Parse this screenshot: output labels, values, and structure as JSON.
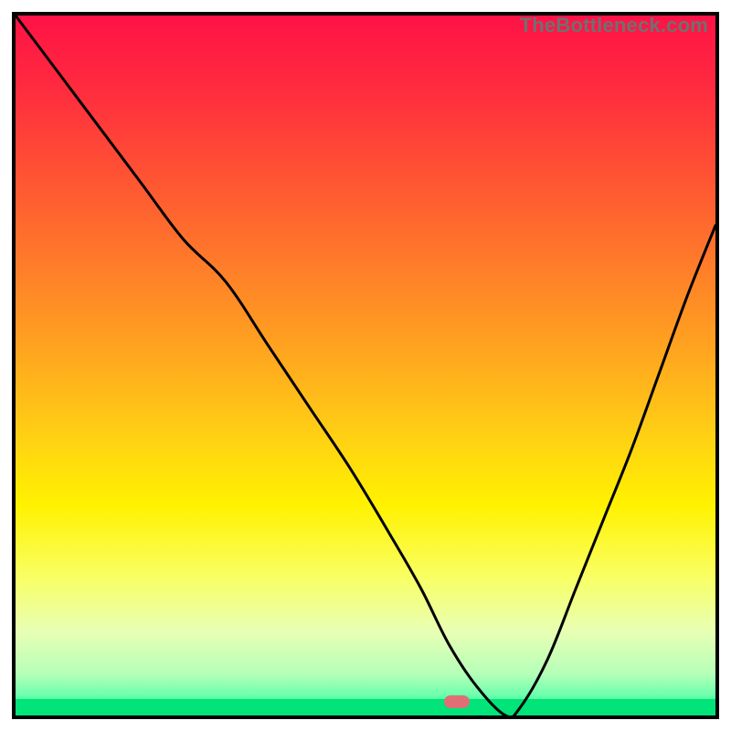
{
  "watermark": {
    "text": "TheBottleneck.com"
  },
  "chart_data": {
    "type": "line",
    "title": "",
    "xlabel": "",
    "ylabel": "",
    "xlim": [
      0,
      100
    ],
    "ylim": [
      0,
      100
    ],
    "grid": false,
    "legend": false,
    "series": [
      {
        "name": "bottleneck-curve",
        "x": [
          0,
          6,
          12,
          18,
          24,
          30,
          36,
          42,
          48,
          54,
          58,
          62,
          66,
          70,
          72,
          76,
          80,
          84,
          88,
          92,
          96,
          100
        ],
        "values": [
          100,
          92,
          84,
          76,
          68,
          62,
          53,
          44,
          35,
          25,
          18,
          10,
          4,
          0,
          1,
          8,
          18,
          28,
          38,
          49,
          60,
          70
        ]
      }
    ],
    "marker": {
      "x": 63,
      "y": 2
    },
    "gradient": {
      "stops": [
        {
          "offset": 0.0,
          "color": "#ff1246"
        },
        {
          "offset": 0.1,
          "color": "#ff2a3f"
        },
        {
          "offset": 0.22,
          "color": "#ff5034"
        },
        {
          "offset": 0.35,
          "color": "#ff7a2a"
        },
        {
          "offset": 0.48,
          "color": "#ffa51f"
        },
        {
          "offset": 0.6,
          "color": "#ffd014"
        },
        {
          "offset": 0.7,
          "color": "#fff200"
        },
        {
          "offset": 0.8,
          "color": "#f9ff62"
        },
        {
          "offset": 0.88,
          "color": "#e8ffb4"
        },
        {
          "offset": 0.94,
          "color": "#b6ffb8"
        },
        {
          "offset": 0.97,
          "color": "#6fffae"
        },
        {
          "offset": 1.0,
          "color": "#00e47a"
        }
      ]
    }
  }
}
